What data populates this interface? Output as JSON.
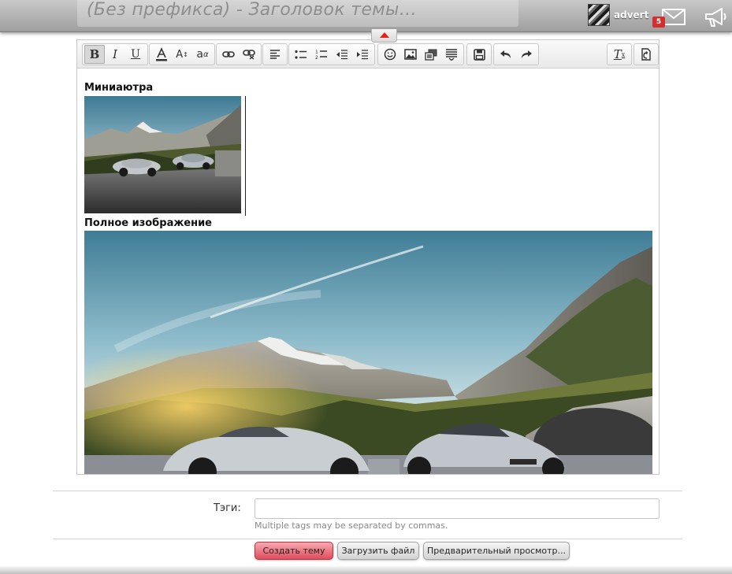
{
  "header": {
    "thread_title": "(Без префикса) -  Заголовок темы…",
    "username": "advert",
    "notification_count": "5"
  },
  "editor": {
    "thumbnail_label": "Миниаютра",
    "full_image_label": "Полное изображение"
  },
  "tags": {
    "label": "Тэги:",
    "value": "",
    "hint": "Multiple tags may be separated by commas."
  },
  "actions": {
    "create_label": "Создать тему",
    "upload_label": "Загрузить файл",
    "preview_label": "Предварительный просмотр..."
  },
  "colors": {
    "accent": "#e04d5c",
    "badge": "#d32f2f",
    "collapse_arrow": "#e2231a"
  },
  "toolbar_icons": [
    "bold-icon",
    "italic-icon",
    "underline-icon",
    "text-color-icon",
    "font-size-icon",
    "font-family-icon",
    "link-icon",
    "unlink-icon",
    "align-left-icon",
    "bullet-list-icon",
    "numbered-list-icon",
    "outdent-icon",
    "indent-icon",
    "smilie-icon",
    "image-icon",
    "media-icon",
    "insert-more-icon",
    "save-draft-icon",
    "undo-icon",
    "redo-icon",
    "remove-format-icon",
    "toggle-bbcode-icon"
  ]
}
